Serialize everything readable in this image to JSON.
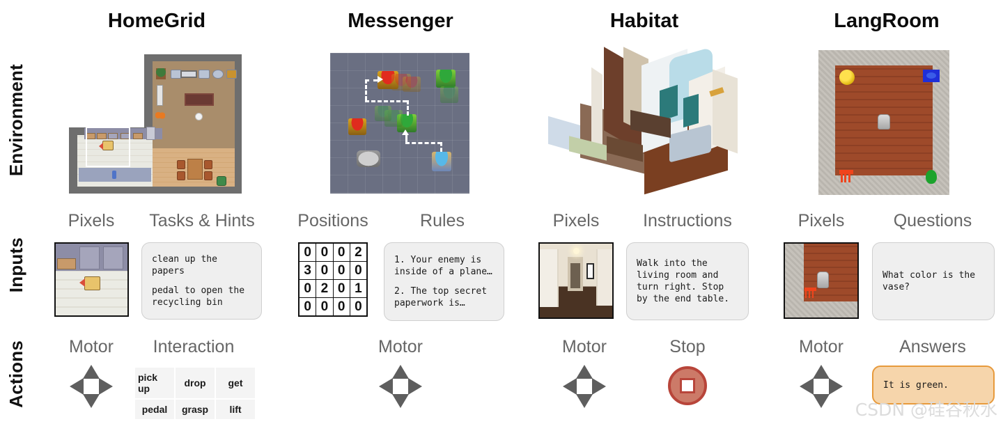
{
  "rows": [
    {
      "label": "Environment"
    },
    {
      "label": "Inputs"
    },
    {
      "label": "Actions"
    }
  ],
  "columns": [
    {
      "title": "HomeGrid",
      "inputs": [
        {
          "heading": "Pixels",
          "kind": "image-thumbnail"
        },
        {
          "heading": "Tasks & Hints",
          "kind": "text-bubble",
          "lines": [
            "clean up the papers",
            "pedal to open the recycling bin"
          ]
        }
      ],
      "actions": [
        {
          "heading": "Motor",
          "kind": "dpad"
        },
        {
          "heading": "Interaction",
          "kind": "table",
          "cells": [
            "pick up",
            "drop",
            "get",
            "pedal",
            "grasp",
            "lift"
          ]
        }
      ]
    },
    {
      "title": "Messenger",
      "inputs": [
        {
          "heading": "Positions",
          "kind": "grid",
          "grid": [
            [
              0,
              0,
              0,
              2
            ],
            [
              3,
              0,
              0,
              0
            ],
            [
              0,
              2,
              0,
              1
            ],
            [
              0,
              0,
              0,
              0
            ]
          ]
        },
        {
          "heading": "Rules",
          "kind": "text-bubble",
          "lines": [
            "1. Your enemy is inside of a plane…",
            "2. The top secret paperwork is…"
          ]
        }
      ],
      "actions": [
        {
          "heading": "Motor",
          "kind": "dpad"
        }
      ]
    },
    {
      "title": "Habitat",
      "inputs": [
        {
          "heading": "Pixels",
          "kind": "image-thumbnail"
        },
        {
          "heading": "Instructions",
          "kind": "text-bubble",
          "lines": [
            "Walk into the living room and turn right. Stop by the end table."
          ]
        }
      ],
      "actions": [
        {
          "heading": "Motor",
          "kind": "dpad"
        },
        {
          "heading": "Stop",
          "kind": "stop-button"
        }
      ]
    },
    {
      "title": "LangRoom",
      "inputs": [
        {
          "heading": "Pixels",
          "kind": "image-thumbnail"
        },
        {
          "heading": "Questions",
          "kind": "text-bubble",
          "lines": [
            "What color is the vase?"
          ]
        }
      ],
      "actions": [
        {
          "heading": "Motor",
          "kind": "dpad"
        },
        {
          "heading": "Answers",
          "kind": "answer-bubble",
          "lines": [
            "It is green."
          ]
        }
      ]
    }
  ],
  "watermark": "CSDN @硅谷秋水",
  "colors": {
    "title": "#0b0b0b",
    "subheading": "#666666",
    "bubble_bg": "#efefef",
    "bubble_border": "#cfcfcf",
    "answer_bg": "#f6d5ab",
    "answer_border": "#e79a3c",
    "stop_fill": "#cc7a68",
    "stop_border": "#b8453a",
    "dpad": "#5e5e5e"
  }
}
